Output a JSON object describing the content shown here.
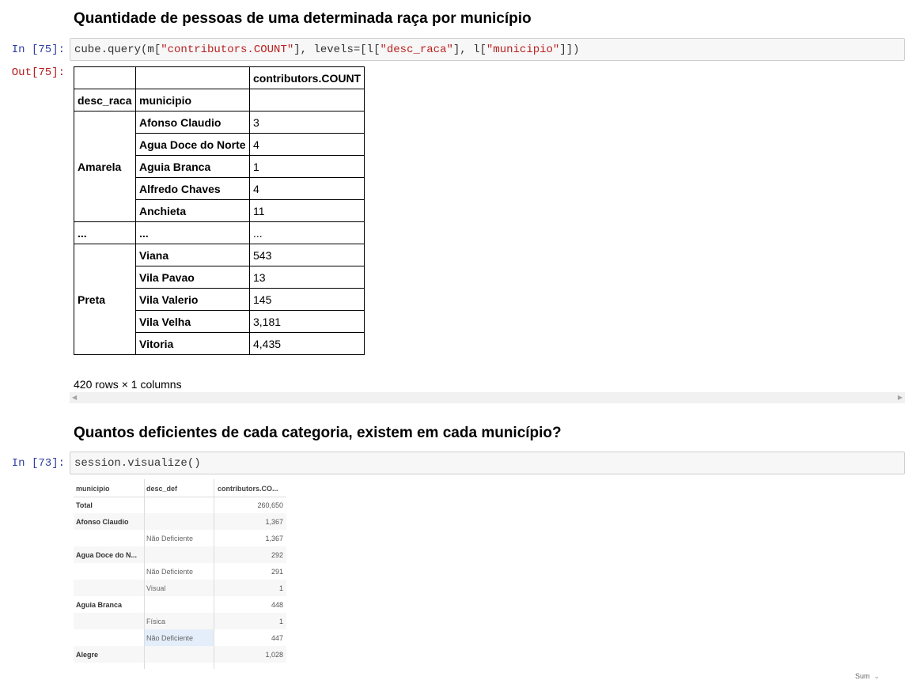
{
  "cell1": {
    "heading": "Quantidade de pessoas de uma determinada raça por município",
    "in_prompt": "In [75]:",
    "out_prompt": "Out[75]:",
    "code": {
      "p1": "cube.query(m[",
      "s1": "\"contributors.COUNT\"",
      "p2": "], levels=[l[",
      "s2": "\"desc_raca\"",
      "p3": "], l[",
      "s3": "\"municipio\"",
      "p4": "]])"
    },
    "table": {
      "value_header": "contributors.COUNT",
      "index_names": [
        "desc_raca",
        "municipio"
      ],
      "ellipsis": "...",
      "groups": [
        {
          "name": "Amarela",
          "rows": [
            {
              "municipio": "Afonso Claudio",
              "value": "3"
            },
            {
              "municipio": "Agua Doce do Norte",
              "value": "4"
            },
            {
              "municipio": "Aguia Branca",
              "value": "1"
            },
            {
              "municipio": "Alfredo Chaves",
              "value": "4"
            },
            {
              "municipio": "Anchieta",
              "value": "11"
            }
          ]
        },
        {
          "name": "Preta",
          "rows": [
            {
              "municipio": "Viana",
              "value": "543"
            },
            {
              "municipio": "Vila Pavao",
              "value": "13"
            },
            {
              "municipio": "Vila Valerio",
              "value": "145"
            },
            {
              "municipio": "Vila Velha",
              "value": "3,181"
            },
            {
              "municipio": "Vitoria",
              "value": "4,435"
            }
          ]
        }
      ]
    },
    "row_count": "420 rows × 1 columns"
  },
  "cell2": {
    "heading": "Quantos deficientes de cada categoria, existem em cada município?",
    "in_prompt": "In [73]:",
    "code": "session.visualize()",
    "grid": {
      "headers": [
        "municipio",
        "desc_def",
        "contributors.CO..."
      ],
      "rows": [
        {
          "c1": "Total",
          "c2": "",
          "value": "260,650"
        },
        {
          "c1": "Afonso Claudio",
          "c2": "",
          "value": "1,367"
        },
        {
          "c1": "",
          "c2": "Não Deficiente",
          "value": "1,367"
        },
        {
          "c1": "Agua Doce do N...",
          "c2": "",
          "value": "292"
        },
        {
          "c1": "",
          "c2": "Não Deficiente",
          "value": "291"
        },
        {
          "c1": "",
          "c2": "Visual",
          "value": "1"
        },
        {
          "c1": "Aguia Branca",
          "c2": "",
          "value": "448"
        },
        {
          "c1": "",
          "c2": "Física",
          "value": "1"
        },
        {
          "c1": "",
          "c2": "Não Deficiente",
          "value": "447"
        },
        {
          "c1": "Alegre",
          "c2": "",
          "value": "1,028"
        }
      ],
      "aggregation": "Sum"
    }
  }
}
